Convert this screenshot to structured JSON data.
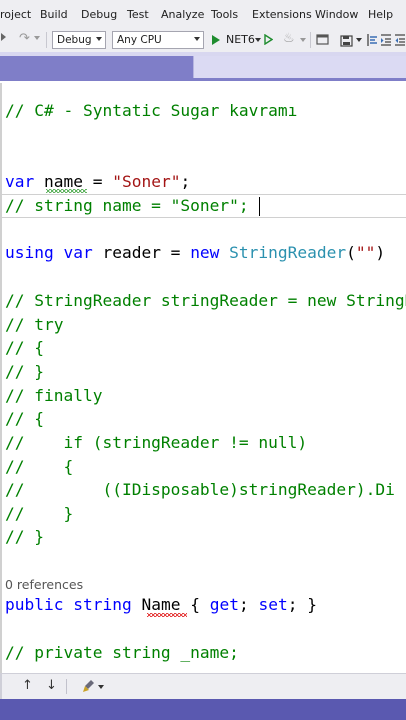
{
  "menu": {
    "items": [
      "roject",
      "Build",
      "Debug",
      "Test",
      "Analyze",
      "Tools",
      "Extensions",
      "Window",
      "Help"
    ]
  },
  "toolbar": {
    "config_value": "Debug",
    "platform_value": "Any CPU",
    "run_target": "NET6"
  },
  "editor": {
    "line_title": "// C# - Syntatic Sugar kavramı",
    "line_var_kw": "var",
    "line_var_name": " name",
    "line_var_eq": " = ",
    "line_var_str": "\"Soner\"",
    "line_var_semi": ";",
    "line_comment_string": "// string name = \"Soner\";",
    "line_using_kw": "using var",
    "line_using_reader": " reader = ",
    "line_using_new": "new",
    "line_using_type": " StringReader",
    "line_using_paren_open": "(",
    "line_using_str": "\"\"",
    "line_using_paren_close": ")",
    "c1": "// StringReader stringReader = new StringR",
    "c2": "// try",
    "c3": "// {",
    "c4": "// }",
    "c5": "// finally",
    "c6": "// {",
    "c7": "//    if (stringReader != null)",
    "c8": "//    {",
    "c9": "//        ((IDisposable)stringReader).Di",
    "c10": "//    }",
    "c11": "// }",
    "references": "0 references",
    "prop_public": "public",
    "prop_string": " string",
    "prop_name": " Name",
    "prop_rest_open": " { ",
    "prop_get": "get",
    "prop_semi1": "; ",
    "prop_set": "set",
    "prop_rest_close": "; }",
    "last_comment": "// private string _name;"
  }
}
